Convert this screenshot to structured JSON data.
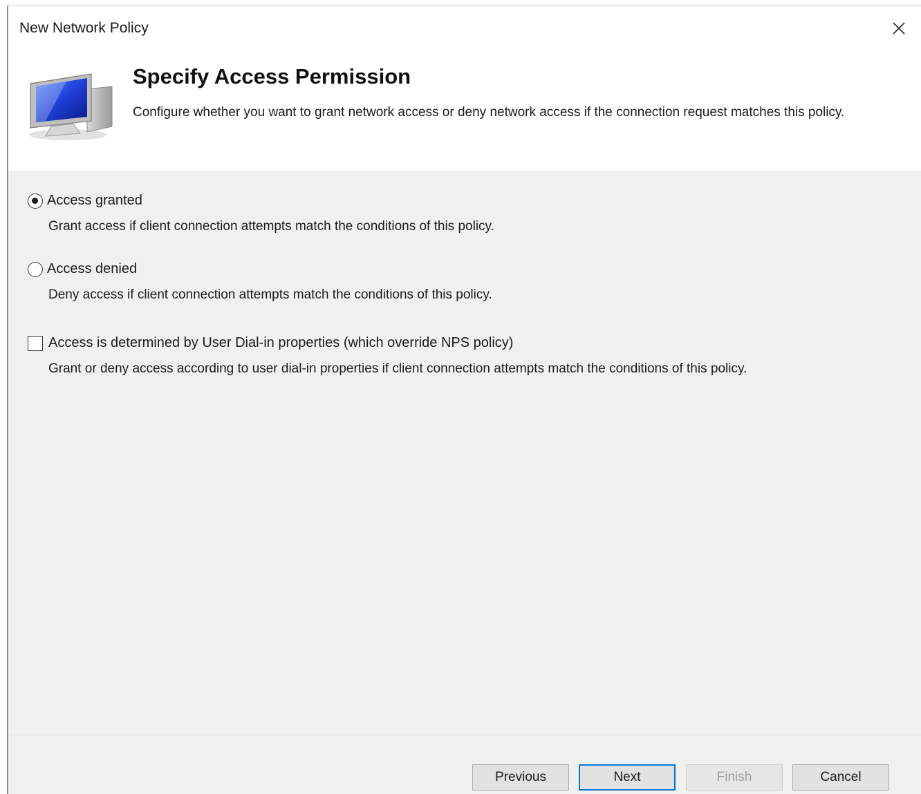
{
  "window": {
    "title": "New Network Policy"
  },
  "header": {
    "title": "Specify Access Permission",
    "description": "Configure whether you want to grant network access or deny network access if the connection request matches this policy."
  },
  "options": {
    "granted": {
      "label": "Access granted",
      "description": "Grant access if client connection attempts match the conditions of this policy.",
      "selected": true
    },
    "denied": {
      "label": "Access denied",
      "description": "Deny access if client connection attempts match the conditions of this policy.",
      "selected": false
    },
    "dialin": {
      "label": "Access is determined by User Dial-in properties (which override NPS policy)",
      "description": "Grant or deny access according to user dial-in properties if client connection attempts match the conditions of this policy.",
      "checked": false
    }
  },
  "buttons": {
    "previous": "Previous",
    "next": "Next",
    "finish": "Finish",
    "cancel": "Cancel"
  },
  "icons": {
    "close": "close-icon",
    "header": "monitor-network-icon"
  },
  "colors": {
    "accent": "#0078d7",
    "content_bg": "#f0f0f0"
  }
}
